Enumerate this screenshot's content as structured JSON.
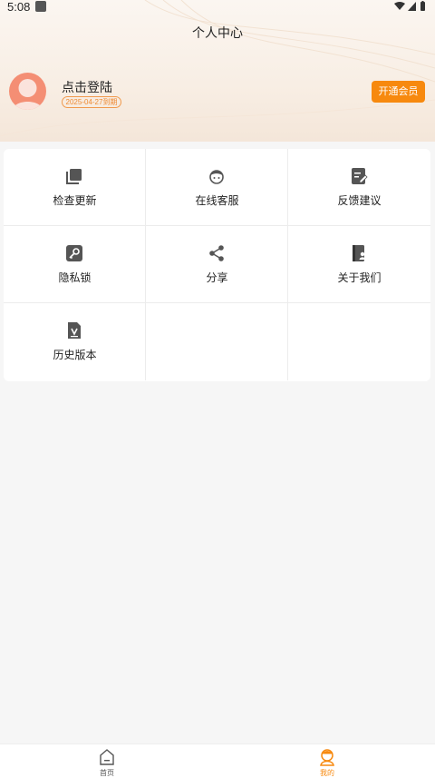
{
  "status_bar": {
    "time": "5:08"
  },
  "header": {
    "title": "个人中心"
  },
  "profile": {
    "login_text": "点击登陆",
    "expire_text": "2025-04-27到期",
    "vip_button": "开通会员"
  },
  "grid": {
    "items": [
      {
        "label": "检查更新",
        "icon": "copy-icon"
      },
      {
        "label": "在线客服",
        "icon": "customer-service-icon"
      },
      {
        "label": "反馈建议",
        "icon": "feedback-edit-icon"
      },
      {
        "label": "隐私锁",
        "icon": "key-icon"
      },
      {
        "label": "分享",
        "icon": "share-icon"
      },
      {
        "label": "关于我们",
        "icon": "about-book-icon"
      },
      {
        "label": "历史版本",
        "icon": "version-file-icon"
      }
    ]
  },
  "bottom_nav": {
    "items": [
      {
        "label": "首页",
        "icon": "home-icon",
        "active": false
      },
      {
        "label": "我的",
        "icon": "user-icon",
        "active": true
      }
    ]
  },
  "colors": {
    "accent": "#f7890e",
    "icon_gray": "#555555",
    "nav_inactive": "#555555",
    "avatar_bg": "#f48e74"
  }
}
